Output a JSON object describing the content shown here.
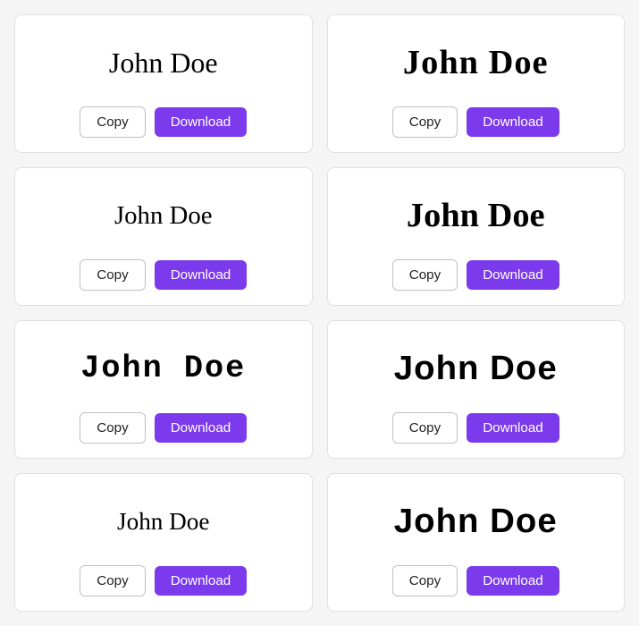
{
  "cards": [
    {
      "id": "card-1",
      "name": "John Doe",
      "fontClass": "font-cursive-1",
      "copyLabel": "Copy",
      "downloadLabel": "Download"
    },
    {
      "id": "card-2",
      "name": "John Doe",
      "fontClass": "font-serif-bold",
      "copyLabel": "Copy",
      "downloadLabel": "Download"
    },
    {
      "id": "card-3",
      "name": "John Doe",
      "fontClass": "font-cursive-2",
      "copyLabel": "Copy",
      "downloadLabel": "Download"
    },
    {
      "id": "card-4",
      "name": "John Doe",
      "fontClass": "font-serif-bold-2",
      "copyLabel": "Copy",
      "downloadLabel": "Download"
    },
    {
      "id": "card-5",
      "name": "John Doe",
      "fontClass": "font-mono-bold",
      "copyLabel": "Copy",
      "downloadLabel": "Download"
    },
    {
      "id": "card-6",
      "name": "John Doe",
      "fontClass": "font-sans-bold",
      "copyLabel": "Copy",
      "downloadLabel": "Download"
    },
    {
      "id": "card-7",
      "name": "John Doe",
      "fontClass": "font-handwritten",
      "copyLabel": "Copy",
      "downloadLabel": "Download"
    },
    {
      "id": "card-8",
      "name": "John Doe",
      "fontClass": "font-sans-bold",
      "copyLabel": "Copy",
      "downloadLabel": "Download"
    }
  ]
}
